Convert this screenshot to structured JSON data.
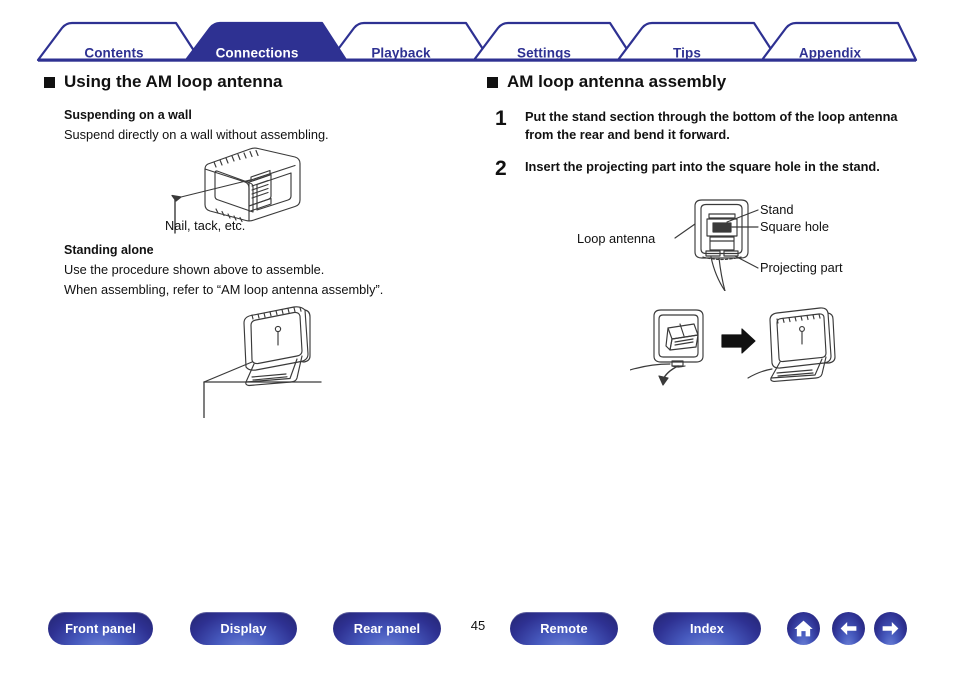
{
  "tabs": [
    {
      "label": "Contents",
      "active": false
    },
    {
      "label": "Connections",
      "active": true
    },
    {
      "label": "Playback",
      "active": false
    },
    {
      "label": "Settings",
      "active": false
    },
    {
      "label": "Tips",
      "active": false
    },
    {
      "label": "Appendix",
      "active": false
    }
  ],
  "left": {
    "heading": "Using the AM loop antenna",
    "sub1": "Suspending on a wall",
    "sub1_line1": "Suspend directly on a wall without assembling.",
    "fig1_caption": "Nail, tack, etc.",
    "sub2": "Standing alone",
    "sub2_line1": "Use the procedure shown above to assemble.",
    "sub2_line2": "When assembling, refer to “AM loop antenna assembly”."
  },
  "right": {
    "heading": "AM loop antenna assembly",
    "steps": [
      {
        "num": "1",
        "text": "Put the stand section through the bottom of the loop antenna from the rear and bend it forward."
      },
      {
        "num": "2",
        "text": "Insert the projecting part into the square hole in the stand."
      }
    ],
    "callouts": {
      "stand": "Stand",
      "square_hole": "Square hole",
      "loop_antenna": "Loop antenna",
      "projecting_part": "Projecting part"
    }
  },
  "bottom": {
    "buttons": [
      {
        "label": "Front panel"
      },
      {
        "label": "Display"
      },
      {
        "label": "Rear panel"
      },
      {
        "label": "Remote"
      },
      {
        "label": "Index"
      }
    ],
    "page_number": "45",
    "icons": [
      {
        "name": "home-icon"
      },
      {
        "name": "back-arrow-icon"
      },
      {
        "name": "forward-arrow-icon"
      }
    ]
  },
  "colors": {
    "brand_blue": "#2e3192",
    "ink": "#111111"
  }
}
